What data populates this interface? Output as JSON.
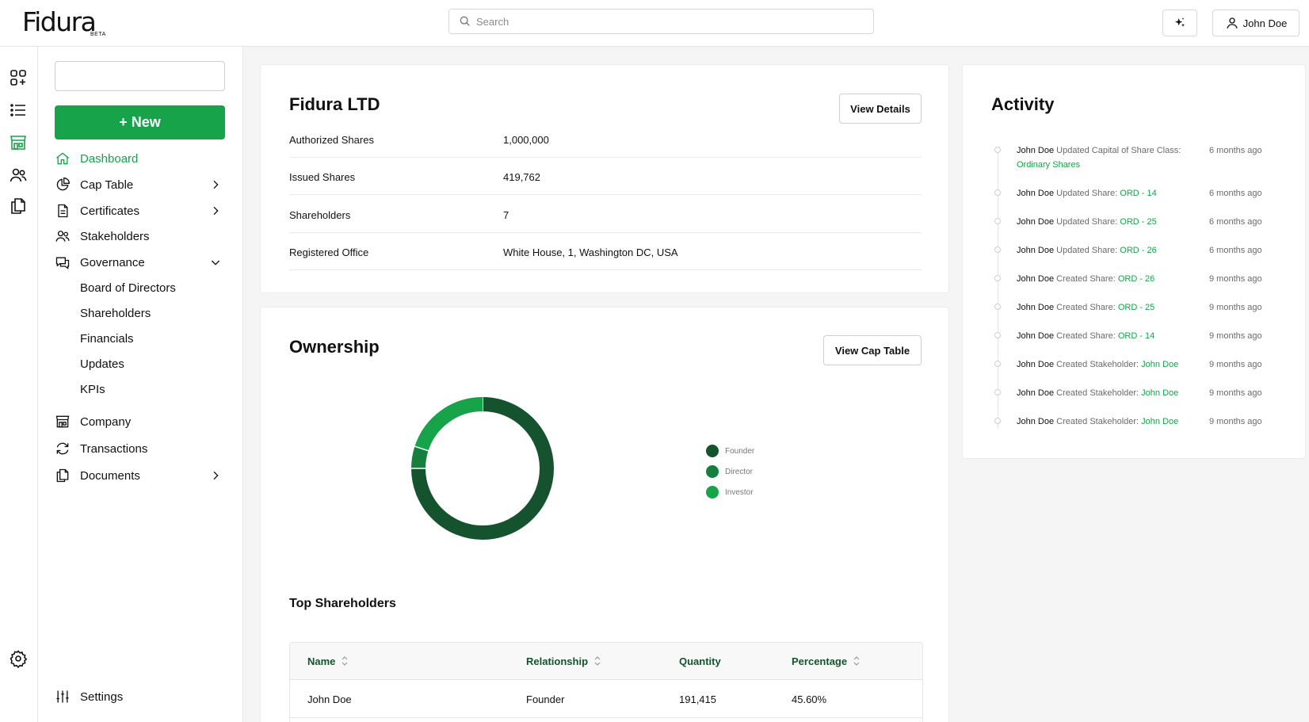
{
  "app": {
    "logo": "Fidura",
    "beta": "BETA"
  },
  "search": {
    "placeholder": "Search"
  },
  "user": {
    "name": "John Doe"
  },
  "sidebar": {
    "new_label": "+ New",
    "items": [
      {
        "label": "Dashboard",
        "icon": "home-icon",
        "active": true
      },
      {
        "label": "Cap Table",
        "icon": "pie-chart-icon",
        "chevron": "right"
      },
      {
        "label": "Certificates",
        "icon": "document-icon",
        "chevron": "right"
      },
      {
        "label": "Stakeholders",
        "icon": "users-icon"
      },
      {
        "label": "Governance",
        "icon": "chat-icon",
        "chevron": "down"
      },
      {
        "label": "Company",
        "icon": "building-icon"
      },
      {
        "label": "Transactions",
        "icon": "refresh-icon"
      },
      {
        "label": "Documents",
        "icon": "documents-icon",
        "chevron": "right"
      }
    ],
    "governance_sub": [
      "Board of Directors",
      "Shareholders",
      "Financials",
      "Updates",
      "KPIs"
    ],
    "settings_label": "Settings"
  },
  "company": {
    "name": "Fidura LTD",
    "view_details": "View Details",
    "rows": [
      {
        "label": "Authorized Shares",
        "value": "1,000,000"
      },
      {
        "label": "Issued Shares",
        "value": "419,762"
      },
      {
        "label": "Shareholders",
        "value": "7"
      },
      {
        "label": "Registered Office",
        "value": "White House, 1, Washington DC, USA"
      }
    ]
  },
  "ownership": {
    "title": "Ownership",
    "view_cap_table": "View Cap Table",
    "top_title": "Top Shareholders",
    "columns": [
      "Name",
      "Relationship",
      "Quantity",
      "Percentage"
    ],
    "rows": [
      {
        "name": "John Doe",
        "relationship": "Founder",
        "quantity": "191,415",
        "percentage": "45.60%"
      }
    ]
  },
  "chart_data": {
    "type": "pie",
    "donut": true,
    "categories": [
      "Founder",
      "Director",
      "Investor"
    ],
    "values": [
      75,
      5,
      20
    ],
    "colors": [
      "#14532d",
      "#15803d",
      "#16a34a"
    ],
    "legend": "right"
  },
  "activity": {
    "title": "Activity",
    "items": [
      {
        "who": "John Doe",
        "text": "Updated Capital of Share Class:",
        "link": "Ordinary Shares",
        "time": "6 months ago"
      },
      {
        "who": "John Doe",
        "text": "Updated Share:",
        "link": "ORD - 14",
        "time": "6 months ago"
      },
      {
        "who": "John Doe",
        "text": "Updated Share:",
        "link": "ORD - 25",
        "time": "6 months ago"
      },
      {
        "who": "John Doe",
        "text": "Updated Share:",
        "link": "ORD - 26",
        "time": "6 months ago"
      },
      {
        "who": "John Doe",
        "text": "Created Share:",
        "link": "ORD - 26",
        "time": "9 months ago"
      },
      {
        "who": "John Doe",
        "text": "Created Share:",
        "link": "ORD - 25",
        "time": "9 months ago"
      },
      {
        "who": "John Doe",
        "text": "Created Share:",
        "link": "ORD - 14",
        "time": "9 months ago"
      },
      {
        "who": "John Doe",
        "text": "Created Stakeholder:",
        "link": "John Doe",
        "time": "9 months ago"
      },
      {
        "who": "John Doe",
        "text": "Created Stakeholder:",
        "link": "John Doe",
        "time": "9 months ago"
      },
      {
        "who": "John Doe",
        "text": "Created Stakeholder:",
        "link": "John Doe",
        "time": "9 months ago"
      }
    ]
  },
  "colors": {
    "accent": "#16a34a",
    "dark_green": "#14532d"
  }
}
